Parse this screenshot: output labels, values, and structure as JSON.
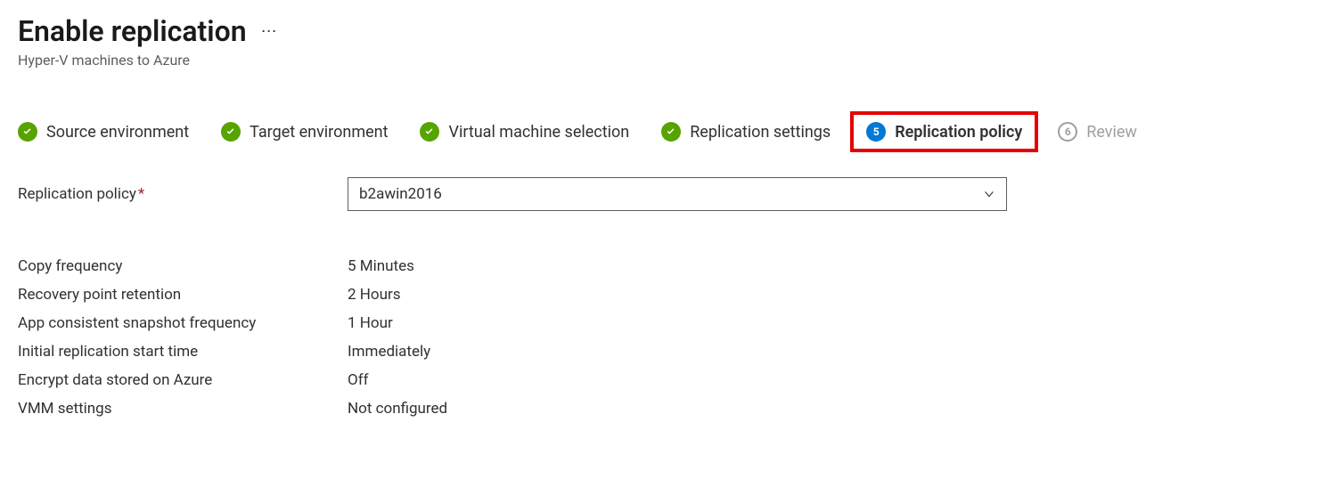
{
  "header": {
    "title": "Enable replication",
    "subtitle": "Hyper-V machines to Azure"
  },
  "steps": [
    {
      "label": "Source environment",
      "status": "done"
    },
    {
      "label": "Target environment",
      "status": "done"
    },
    {
      "label": "Virtual machine selection",
      "status": "done"
    },
    {
      "label": "Replication settings",
      "status": "done"
    },
    {
      "label": "Replication policy",
      "status": "current",
      "number": "5"
    },
    {
      "label": "Review",
      "status": "inactive",
      "number": "6"
    }
  ],
  "form": {
    "policy_label": "Replication policy",
    "policy_value": "b2awin2016"
  },
  "details": [
    {
      "label": "Copy frequency",
      "value": "5 Minutes"
    },
    {
      "label": "Recovery point retention",
      "value": "2 Hours"
    },
    {
      "label": "App consistent snapshot frequency",
      "value": "1 Hour"
    },
    {
      "label": "Initial replication start time",
      "value": "Immediately"
    },
    {
      "label": "Encrypt data stored on Azure",
      "value": "Off"
    },
    {
      "label": "VMM settings",
      "value": "Not configured"
    }
  ]
}
